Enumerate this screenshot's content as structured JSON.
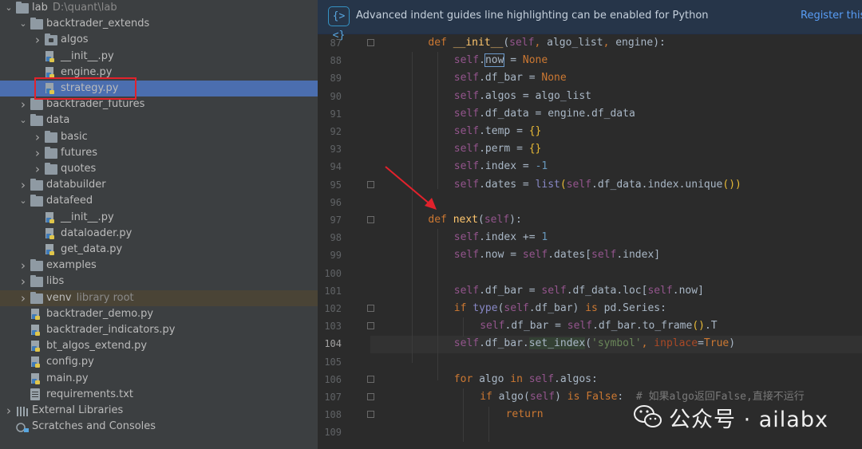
{
  "project_tree": {
    "root": {
      "name": "lab",
      "path": "D:\\quant\\lab"
    },
    "rows": [
      {
        "label": "lab",
        "sub": "D:\\quant\\lab",
        "type": "folder",
        "expanded": true,
        "depth": 0
      },
      {
        "label": "backtrader_extends",
        "type": "folder",
        "expanded": true,
        "depth": 1
      },
      {
        "label": "algos",
        "type": "module-folder",
        "expanded": false,
        "depth": 2
      },
      {
        "label": "__init__.py",
        "type": "py",
        "depth": 2
      },
      {
        "label": "engine.py",
        "type": "py",
        "depth": 2
      },
      {
        "label": "strategy.py",
        "type": "py",
        "depth": 2,
        "selected": true
      },
      {
        "label": "backtrader_futures",
        "type": "folder",
        "expanded": false,
        "depth": 1
      },
      {
        "label": "data",
        "type": "folder",
        "expanded": true,
        "depth": 1
      },
      {
        "label": "basic",
        "type": "folder",
        "expanded": false,
        "depth": 2
      },
      {
        "label": "futures",
        "type": "folder",
        "expanded": false,
        "depth": 2
      },
      {
        "label": "quotes",
        "type": "folder",
        "expanded": false,
        "depth": 2
      },
      {
        "label": "databuilder",
        "type": "folder",
        "expanded": false,
        "depth": 1
      },
      {
        "label": "datafeed",
        "type": "folder",
        "expanded": true,
        "depth": 1
      },
      {
        "label": "__init__.py",
        "type": "py",
        "depth": 2
      },
      {
        "label": "dataloader.py",
        "type": "py",
        "depth": 2
      },
      {
        "label": "get_data.py",
        "type": "py",
        "depth": 2
      },
      {
        "label": "examples",
        "type": "folder",
        "expanded": false,
        "depth": 1
      },
      {
        "label": "libs",
        "type": "folder",
        "expanded": false,
        "depth": 1
      },
      {
        "label": "venv",
        "sub": "library root",
        "type": "folder",
        "expanded": false,
        "depth": 1,
        "venv": true
      },
      {
        "label": "backtrader_demo.py",
        "type": "py",
        "depth": 1
      },
      {
        "label": "backtrader_indicators.py",
        "type": "py",
        "depth": 1
      },
      {
        "label": "bt_algos_extend.py",
        "type": "py",
        "depth": 1
      },
      {
        "label": "config.py",
        "type": "py",
        "depth": 1
      },
      {
        "label": "main.py",
        "type": "py",
        "depth": 1
      },
      {
        "label": "requirements.txt",
        "type": "txt",
        "depth": 1
      },
      {
        "label": "External Libraries",
        "type": "libs",
        "expanded": false,
        "depth": 0
      },
      {
        "label": "Scratches and Consoles",
        "type": "scratch",
        "depth": 0
      }
    ]
  },
  "banner": {
    "icon": "{><}",
    "text": "Advanced indent guides line highlighting can be enabled for Python",
    "link": "Register this"
  },
  "editor": {
    "current_line": 104,
    "lines": [
      {
        "n": 87,
        "indent": 1,
        "tokens": [
          [
            "k",
            "def "
          ],
          [
            "fn",
            "__init__"
          ],
          [
            "",
            "("
          ],
          [
            "s",
            "self"
          ],
          [
            "k",
            ", "
          ],
          [
            "",
            "algo_list"
          ],
          [
            "k",
            ", "
          ],
          [
            "",
            "engine):"
          ]
        ],
        "fold": true
      },
      {
        "n": 88,
        "indent": 2,
        "tokens": [
          [
            "s",
            "self"
          ],
          [
            "",
            "."
          ],
          [
            "box",
            "now"
          ],
          [
            "",
            " = "
          ],
          [
            "k",
            "None"
          ]
        ]
      },
      {
        "n": 89,
        "indent": 2,
        "tokens": [
          [
            "s",
            "self"
          ],
          [
            "",
            ".df_bar = "
          ],
          [
            "k",
            "None"
          ]
        ]
      },
      {
        "n": 90,
        "indent": 2,
        "tokens": [
          [
            "s",
            "self"
          ],
          [
            "",
            ".algos = algo_list"
          ]
        ]
      },
      {
        "n": 91,
        "indent": 2,
        "tokens": [
          [
            "s",
            "self"
          ],
          [
            "",
            ".df_data = engine.df_data"
          ]
        ]
      },
      {
        "n": 92,
        "indent": 2,
        "tokens": [
          [
            "s",
            "self"
          ],
          [
            "",
            ".temp = "
          ],
          [
            "paren",
            "{}"
          ]
        ]
      },
      {
        "n": 93,
        "indent": 2,
        "tokens": [
          [
            "s",
            "self"
          ],
          [
            "",
            ".perm = "
          ],
          [
            "paren",
            "{}"
          ]
        ]
      },
      {
        "n": 94,
        "indent": 2,
        "tokens": [
          [
            "s",
            "self"
          ],
          [
            "",
            ".index = "
          ],
          [
            "n",
            "-1"
          ]
        ]
      },
      {
        "n": 95,
        "indent": 2,
        "tokens": [
          [
            "s",
            "self"
          ],
          [
            "",
            ".dates = "
          ],
          [
            "b",
            "list"
          ],
          [
            "paren",
            "("
          ],
          [
            "s",
            "self"
          ],
          [
            "",
            ".df_data.index.unique"
          ],
          [
            "paren",
            "()"
          ],
          [
            "paren",
            ")"
          ]
        ],
        "fold": true
      },
      {
        "n": 96,
        "indent": 0,
        "tokens": []
      },
      {
        "n": 97,
        "indent": 1,
        "tokens": [
          [
            "k",
            "def "
          ],
          [
            "fn",
            "next"
          ],
          [
            "",
            "("
          ],
          [
            "s",
            "self"
          ],
          [
            "",
            "):"
          ]
        ],
        "fold": true
      },
      {
        "n": 98,
        "indent": 2,
        "tokens": [
          [
            "s",
            "self"
          ],
          [
            "",
            ".index += "
          ],
          [
            "n",
            "1"
          ]
        ]
      },
      {
        "n": 99,
        "indent": 2,
        "tokens": [
          [
            "s",
            "self"
          ],
          [
            "",
            ".now = "
          ],
          [
            "s",
            "self"
          ],
          [
            "",
            ".dates["
          ],
          [
            "s",
            "self"
          ],
          [
            "",
            ".index]"
          ]
        ]
      },
      {
        "n": 100,
        "indent": 0,
        "tokens": []
      },
      {
        "n": 101,
        "indent": 2,
        "tokens": [
          [
            "s",
            "self"
          ],
          [
            "",
            ".df_bar = "
          ],
          [
            "s",
            "self"
          ],
          [
            "",
            ".df_data.loc["
          ],
          [
            "s",
            "self"
          ],
          [
            "",
            ".now]"
          ]
        ]
      },
      {
        "n": 102,
        "indent": 2,
        "tokens": [
          [
            "k",
            "if "
          ],
          [
            "b",
            "type"
          ],
          [
            "",
            "("
          ],
          [
            "s",
            "self"
          ],
          [
            "",
            ".df_bar) "
          ],
          [
            "k",
            "is "
          ],
          [
            "",
            "pd.Series:"
          ]
        ],
        "fold": true
      },
      {
        "n": 103,
        "indent": 3,
        "tokens": [
          [
            "s",
            "self"
          ],
          [
            "",
            ".df_bar = "
          ],
          [
            "s",
            "self"
          ],
          [
            "",
            ".df_bar.to_frame"
          ],
          [
            "paren",
            "()"
          ],
          [
            "",
            ".T"
          ]
        ],
        "fold": true
      },
      {
        "n": 104,
        "indent": 2,
        "tokens": [
          [
            "s",
            "self"
          ],
          [
            "",
            ".df_bar."
          ],
          [
            "under",
            "set_index"
          ],
          [
            "",
            "("
          ],
          [
            "st",
            "'symbol'"
          ],
          [
            "k",
            ", "
          ],
          [
            "kw",
            "inplace"
          ],
          [
            "",
            "="
          ],
          [
            "k",
            "True"
          ],
          [
            "",
            ")"
          ]
        ]
      },
      {
        "n": 105,
        "indent": 0,
        "tokens": []
      },
      {
        "n": 106,
        "indent": 2,
        "tokens": [
          [
            "k",
            "for "
          ],
          [
            "",
            "algo "
          ],
          [
            "k",
            "in "
          ],
          [
            "s",
            "self"
          ],
          [
            "",
            ".algos:"
          ]
        ],
        "fold": true
      },
      {
        "n": 107,
        "indent": 3,
        "tokens": [
          [
            "k",
            "if "
          ],
          [
            "",
            "algo("
          ],
          [
            "s",
            "self"
          ],
          [
            "",
            ") "
          ],
          [
            "k",
            "is False"
          ],
          [
            "",
            ":  "
          ],
          [
            "cm",
            "# 如果algo返回False,直接不运行"
          ]
        ],
        "fold": true
      },
      {
        "n": 108,
        "indent": 4,
        "tokens": [
          [
            "k",
            "return"
          ]
        ],
        "fold": true
      },
      {
        "n": 109,
        "indent": 0,
        "tokens": []
      }
    ]
  },
  "watermark": {
    "text": "公众号 · ailabx"
  },
  "colors": {
    "selection": "#4b6eaf",
    "highlight_box": "#e2222c",
    "annotation_arrow": "#e2222c"
  }
}
